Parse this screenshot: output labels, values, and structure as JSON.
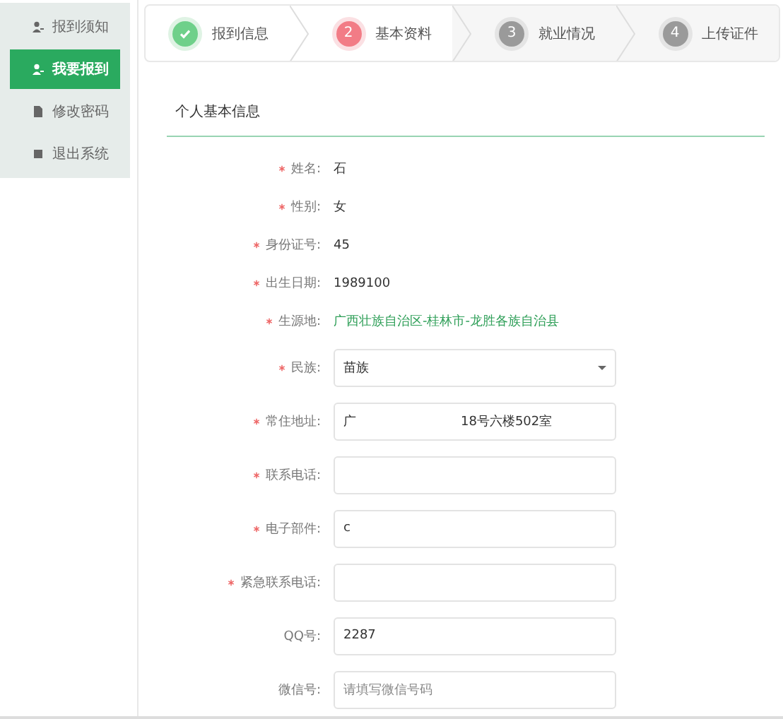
{
  "sidebar": {
    "items": [
      {
        "label": "报到须知",
        "selected": false
      },
      {
        "label": "我要报到",
        "selected": true
      },
      {
        "label": "修改密码",
        "selected": false
      },
      {
        "label": "退出系统",
        "selected": false
      }
    ]
  },
  "steps": [
    {
      "label": "报到信息",
      "kind": "done"
    },
    {
      "number": "2",
      "label": "基本资料",
      "kind": "current"
    },
    {
      "number": "3",
      "label": "就业情况",
      "kind": "todo"
    },
    {
      "number": "4",
      "label": "上传证件",
      "kind": "todo"
    }
  ],
  "section_title": "个人基本信息",
  "info_rows": [
    {
      "label": "姓名:",
      "required": true,
      "value": "石",
      "link": false
    },
    {
      "label": "性别:",
      "required": true,
      "value": "女",
      "link": false
    },
    {
      "label": "身份证号:",
      "required": true,
      "value": "45",
      "link": false
    },
    {
      "label": "出生日期:",
      "required": true,
      "value": "1989100",
      "link": false
    },
    {
      "label": "生源地:",
      "required": true,
      "value": "广西壮族自治区-桂林市-龙胜各族自治县",
      "link": true
    }
  ],
  "fields": [
    {
      "kind": "select",
      "label": "民族:",
      "required": true,
      "value": "苗族"
    },
    {
      "kind": "input",
      "label": "常住地址:",
      "required": true,
      "value": "广",
      "value_tail": "18号六楼502室"
    },
    {
      "kind": "input",
      "label": "联系电话:",
      "required": true
    },
    {
      "kind": "input",
      "label": "电子部件:",
      "required": true,
      "value": "c"
    },
    {
      "kind": "input",
      "label": "紧急联系电话:",
      "required": true
    },
    {
      "kind": "input",
      "label": "QQ号:",
      "required": false,
      "value": "2287"
    },
    {
      "kind": "input",
      "label": "微信号:",
      "required": false,
      "placeholder": "请填写微信号码"
    }
  ]
}
